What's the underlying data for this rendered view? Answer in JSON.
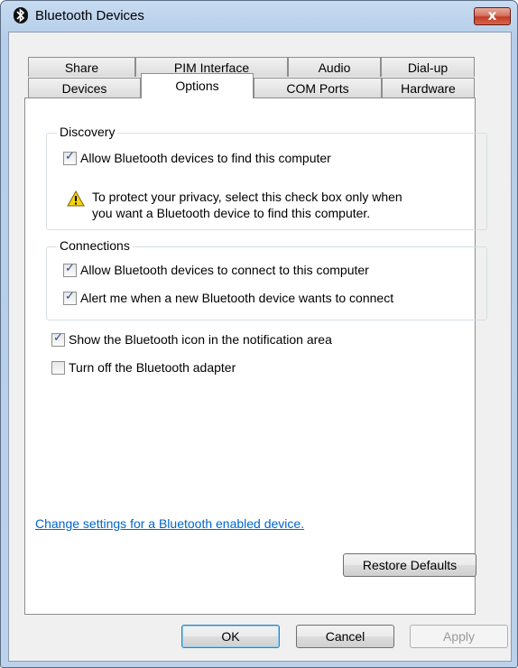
{
  "window": {
    "title": "Bluetooth Devices",
    "close_symbol": "x"
  },
  "tabs_back": [
    {
      "label": "Share"
    },
    {
      "label": "PIM Interface"
    },
    {
      "label": "Audio"
    },
    {
      "label": "Dial-up"
    }
  ],
  "tabs_front": [
    {
      "label": "Devices"
    },
    {
      "label": "Options",
      "active": true
    },
    {
      "label": "COM Ports"
    },
    {
      "label": "Hardware"
    }
  ],
  "discovery": {
    "title": "Discovery",
    "allow_find_label": "Allow Bluetooth devices to find this computer",
    "allow_find_checked": true,
    "warning_line1": "To protect your privacy, select this check box only when",
    "warning_line2": "you want a Bluetooth device to find this computer."
  },
  "connections": {
    "title": "Connections",
    "allow_connect_label": "Allow Bluetooth devices to connect to this computer",
    "allow_connect_checked": true,
    "alert_label": "Alert me when a new Bluetooth device wants to connect",
    "alert_checked": true
  },
  "show_icon": {
    "label": "Show the Bluetooth icon in the notification area",
    "checked": true
  },
  "turn_off": {
    "label": "Turn off the Bluetooth adapter",
    "checked": false
  },
  "link_text": "Change settings for a Bluetooth enabled device.",
  "buttons": {
    "restore": "Restore Defaults",
    "ok": "OK",
    "cancel": "Cancel",
    "apply": "Apply"
  },
  "checkmark": "✓"
}
